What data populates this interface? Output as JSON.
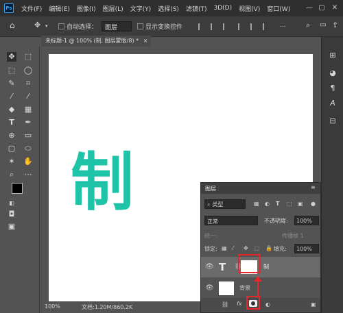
{
  "app": {
    "logo": "Ps"
  },
  "menu": [
    "文件(F)",
    "编辑(E)",
    "图像(I)",
    "图层(L)",
    "文字(Y)",
    "选择(S)",
    "滤镜(T)",
    "3D(D)",
    "视图(V)",
    "窗口(W)"
  ],
  "window_controls": {
    "minimize": "—",
    "restore": "▢",
    "close": "✕"
  },
  "options_bar": {
    "auto_select_label": "自动选择：",
    "auto_select_value": "图层",
    "show_transform_label": "显示变换控件",
    "more": "..."
  },
  "document_tab": {
    "title": "未标题-1 @ 100% (制, 图层蒙版/8) *",
    "close": "×"
  },
  "canvas": {
    "text": "制",
    "text_color": "#1fc3a8"
  },
  "status_bar": {
    "zoom": "100%",
    "doc_info": "文档:1.20M/860.2K"
  },
  "layers_panel": {
    "tab_label": "图层",
    "filter_kind": "类型",
    "blend_mode": "正常",
    "opacity_label": "不透明度:",
    "opacity_value": "100%",
    "unify_label": "统一:",
    "propagate_label": "传播帧 1",
    "lock_label": "锁定:",
    "fill_label": "填充:",
    "fill_value": "100%",
    "layers": [
      {
        "name": "制",
        "type": "text",
        "has_mask": true,
        "selected": true
      },
      {
        "name": "背景",
        "type": "background",
        "has_mask": false,
        "selected": false
      }
    ],
    "footer_fx": "fx"
  },
  "colors": {
    "accent_red": "#e8262b",
    "teal_text": "#1fc3a8"
  }
}
